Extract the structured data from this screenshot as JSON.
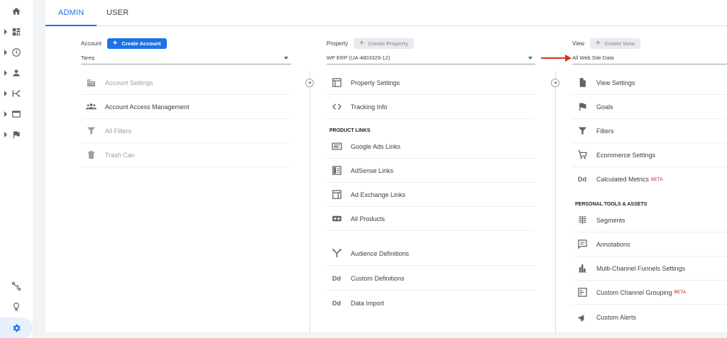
{
  "tabs": {
    "admin": "ADMIN",
    "user": "USER"
  },
  "account": {
    "label": "Account",
    "create_label": "Create Account",
    "selected": "Tareq",
    "items": [
      {
        "label": "Account Settings",
        "icon": "building-icon"
      },
      {
        "label": "Account Access Management",
        "icon": "people-icon"
      },
      {
        "label": "All Filters",
        "icon": "filter-icon"
      },
      {
        "label": "Trash Can",
        "icon": "trash-icon"
      }
    ]
  },
  "property": {
    "label": "Property",
    "create_label": "Create Property",
    "selected": "WP ERP (UA-4803329-12)",
    "items": [
      {
        "label": "Property Settings",
        "icon": "window-icon"
      },
      {
        "label": "Tracking Info",
        "icon": "code-icon"
      }
    ],
    "product_links_heading": "PRODUCT LINKS",
    "product_links": [
      {
        "label": "Google Ads Links",
        "icon": "ads-icon"
      },
      {
        "label": "AdSense Links",
        "icon": "adsense-icon"
      },
      {
        "label": "Ad Exchange Links",
        "icon": "adexchange-icon"
      },
      {
        "label": "All Products",
        "icon": "products-icon"
      }
    ],
    "more_items": [
      {
        "label": "Audience Definitions",
        "icon": "audience-icon"
      },
      {
        "label": "Custom Definitions",
        "icon": "dd-icon",
        "glyph": "Dd"
      },
      {
        "label": "Data Import",
        "icon": "dd-icon",
        "glyph": "Dd"
      }
    ]
  },
  "view": {
    "label": "View",
    "create_label": "Create View",
    "selected": "All Web Site Data",
    "items": [
      {
        "label": "View Settings",
        "icon": "document-icon"
      },
      {
        "label": "Goals",
        "icon": "flag-icon"
      },
      {
        "label": "Filters",
        "icon": "filter-icon"
      },
      {
        "label": "Ecommerce Settings",
        "icon": "cart-icon"
      },
      {
        "label": "Calculated Metrics",
        "icon": "dd-icon",
        "glyph": "Dd",
        "badge": "BETA"
      }
    ],
    "personal_heading": "PERSONAL TOOLS & ASSETS",
    "personal_items": [
      {
        "label": "Segments",
        "icon": "segments-icon"
      },
      {
        "label": "Annotations",
        "icon": "comment-icon"
      },
      {
        "label": "Multi-Channel Funnels Settings",
        "icon": "bar-chart-icon"
      },
      {
        "label": "Custom Channel Grouping",
        "icon": "grouping-icon",
        "badge": "BETA"
      },
      {
        "label": "Custom Alerts",
        "icon": "megaphone-icon"
      }
    ]
  },
  "colors": {
    "accent": "#1a73e8",
    "arrow": "#d93025",
    "beta": "#c5221f"
  }
}
